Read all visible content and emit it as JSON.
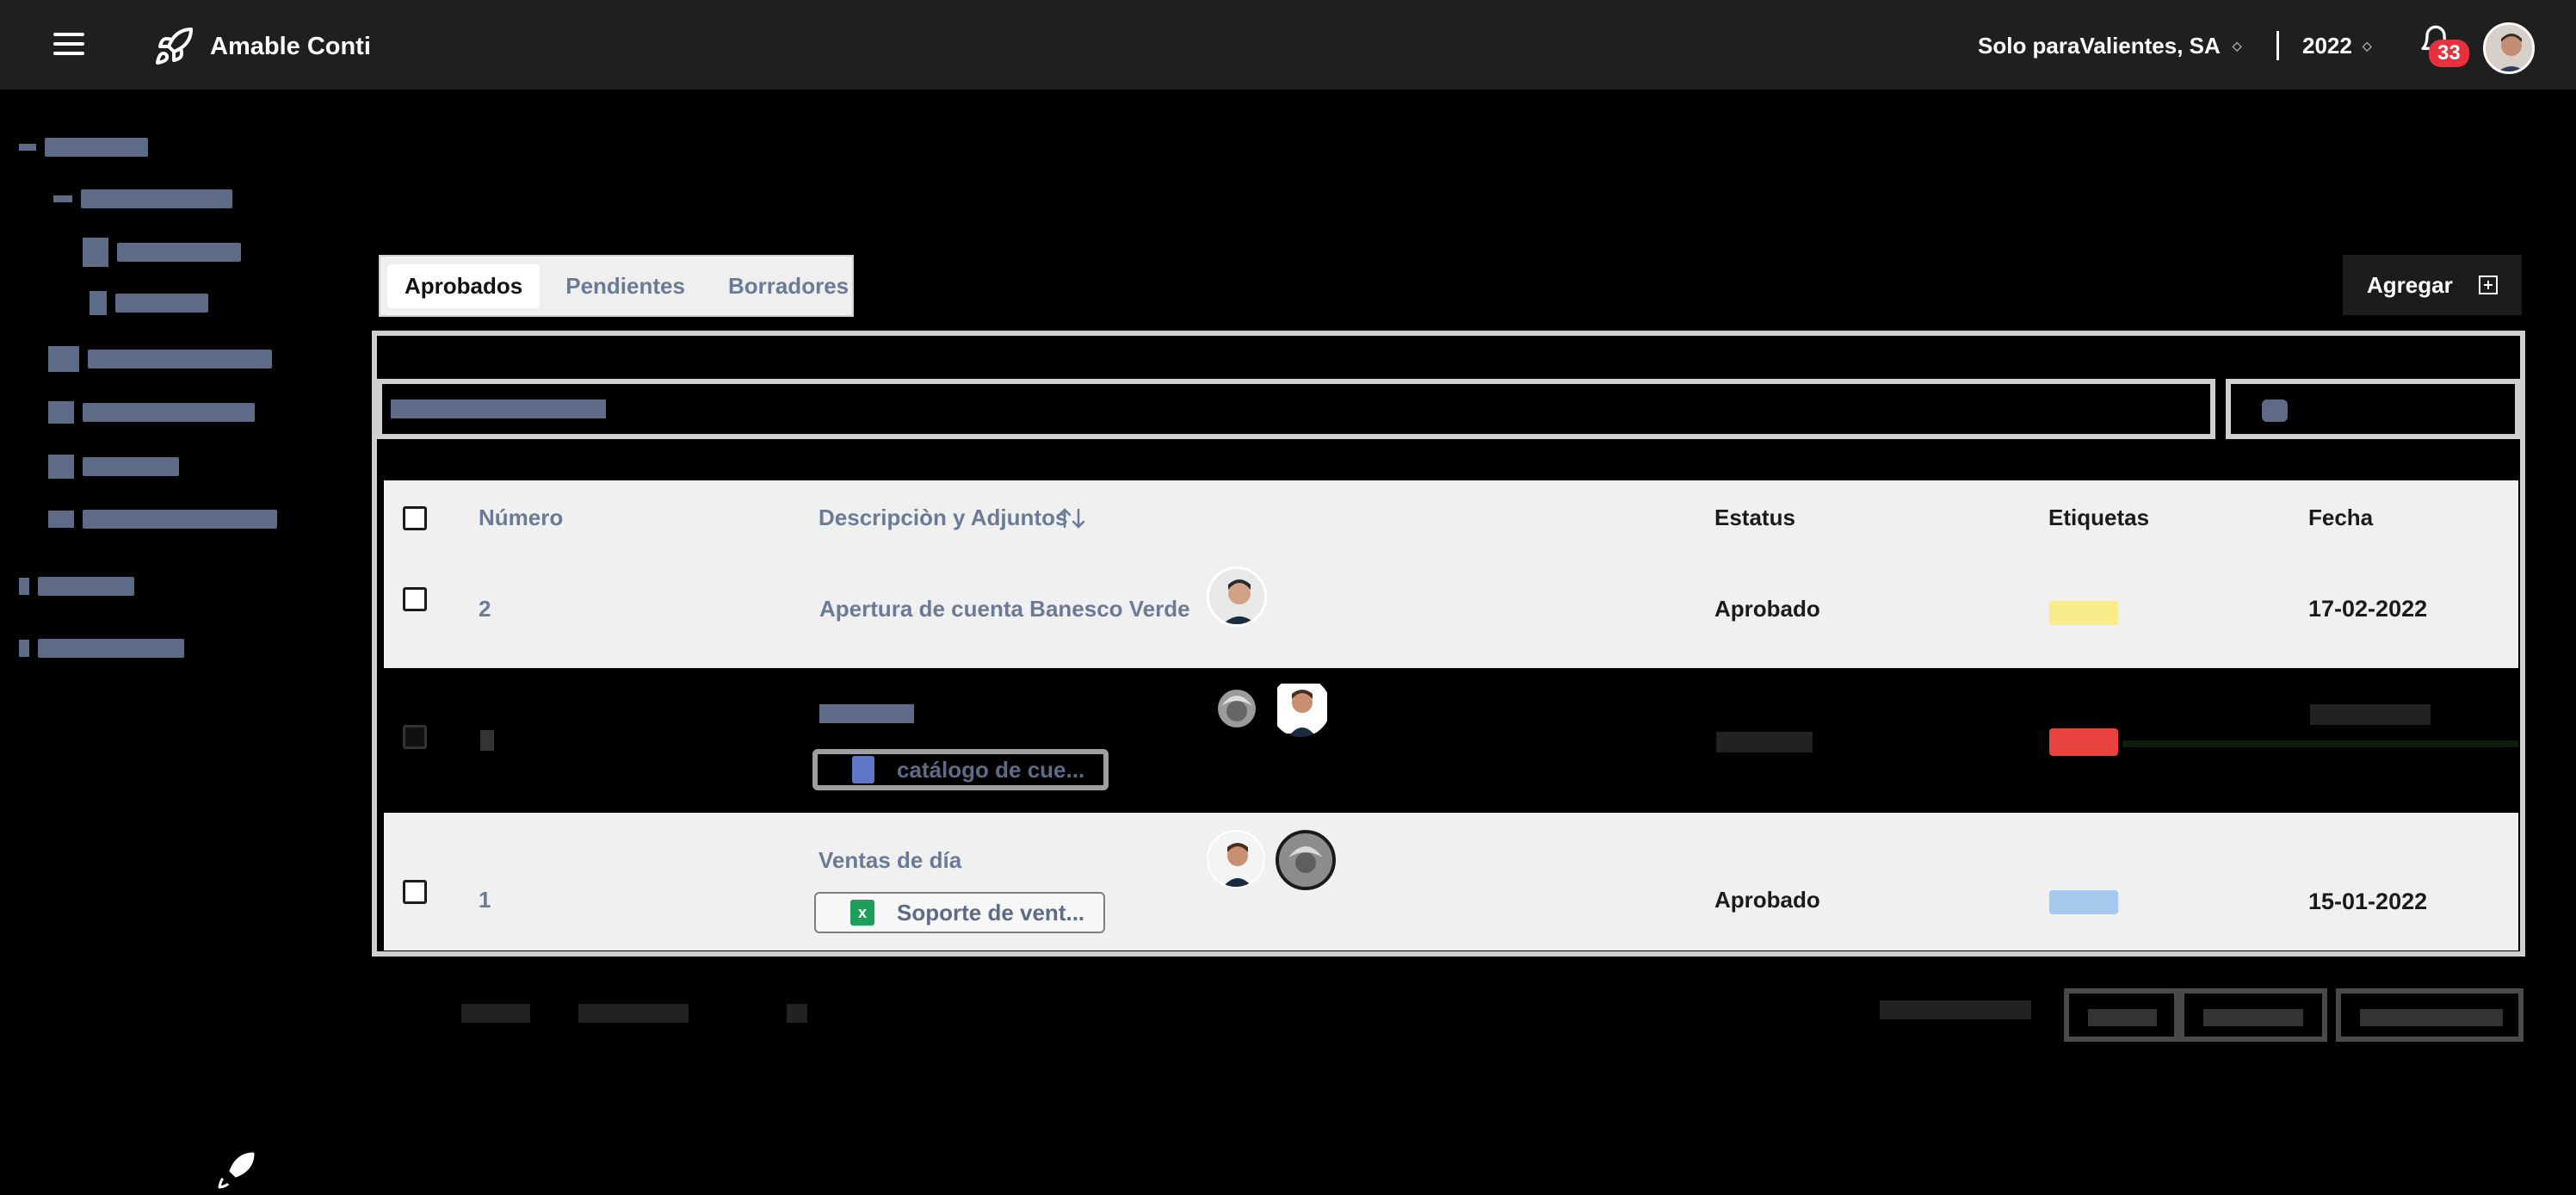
{
  "topbar": {
    "app_name": "Amable Conti",
    "company": "Solo paraValientes, SA",
    "year": "2022",
    "notifications_count": "33"
  },
  "tabs": [
    {
      "label": "Aprobados",
      "active": true
    },
    {
      "label": "Pendientes",
      "active": false
    },
    {
      "label": "Borradores",
      "active": false
    }
  ],
  "add_button": {
    "label": "Agregar"
  },
  "table": {
    "headers": {
      "number": "Número",
      "description": "Descripciòn y Adjuntos",
      "status": "Estatus",
      "tags": "Etiquetas",
      "date": "Fecha"
    },
    "rows": [
      {
        "number": "2",
        "description": "Apertura de cuenta Banesco Verde",
        "status": "Aprobado",
        "tag_color": "#f7ec8a",
        "date": "17-02-2022"
      },
      {
        "attachment": "catálogo de cue...",
        "tag_color": "#e8423e"
      },
      {
        "number": "1",
        "description": "Ventas de día",
        "attachment": "Soporte de vent...",
        "status": "Aprobado",
        "tag_color": "#a8c9ef",
        "date": "15-01-2022"
      }
    ]
  },
  "colors": {
    "topbar": "#1f1f1f",
    "badge": "#e8313f",
    "link_text": "#6b7b97"
  }
}
